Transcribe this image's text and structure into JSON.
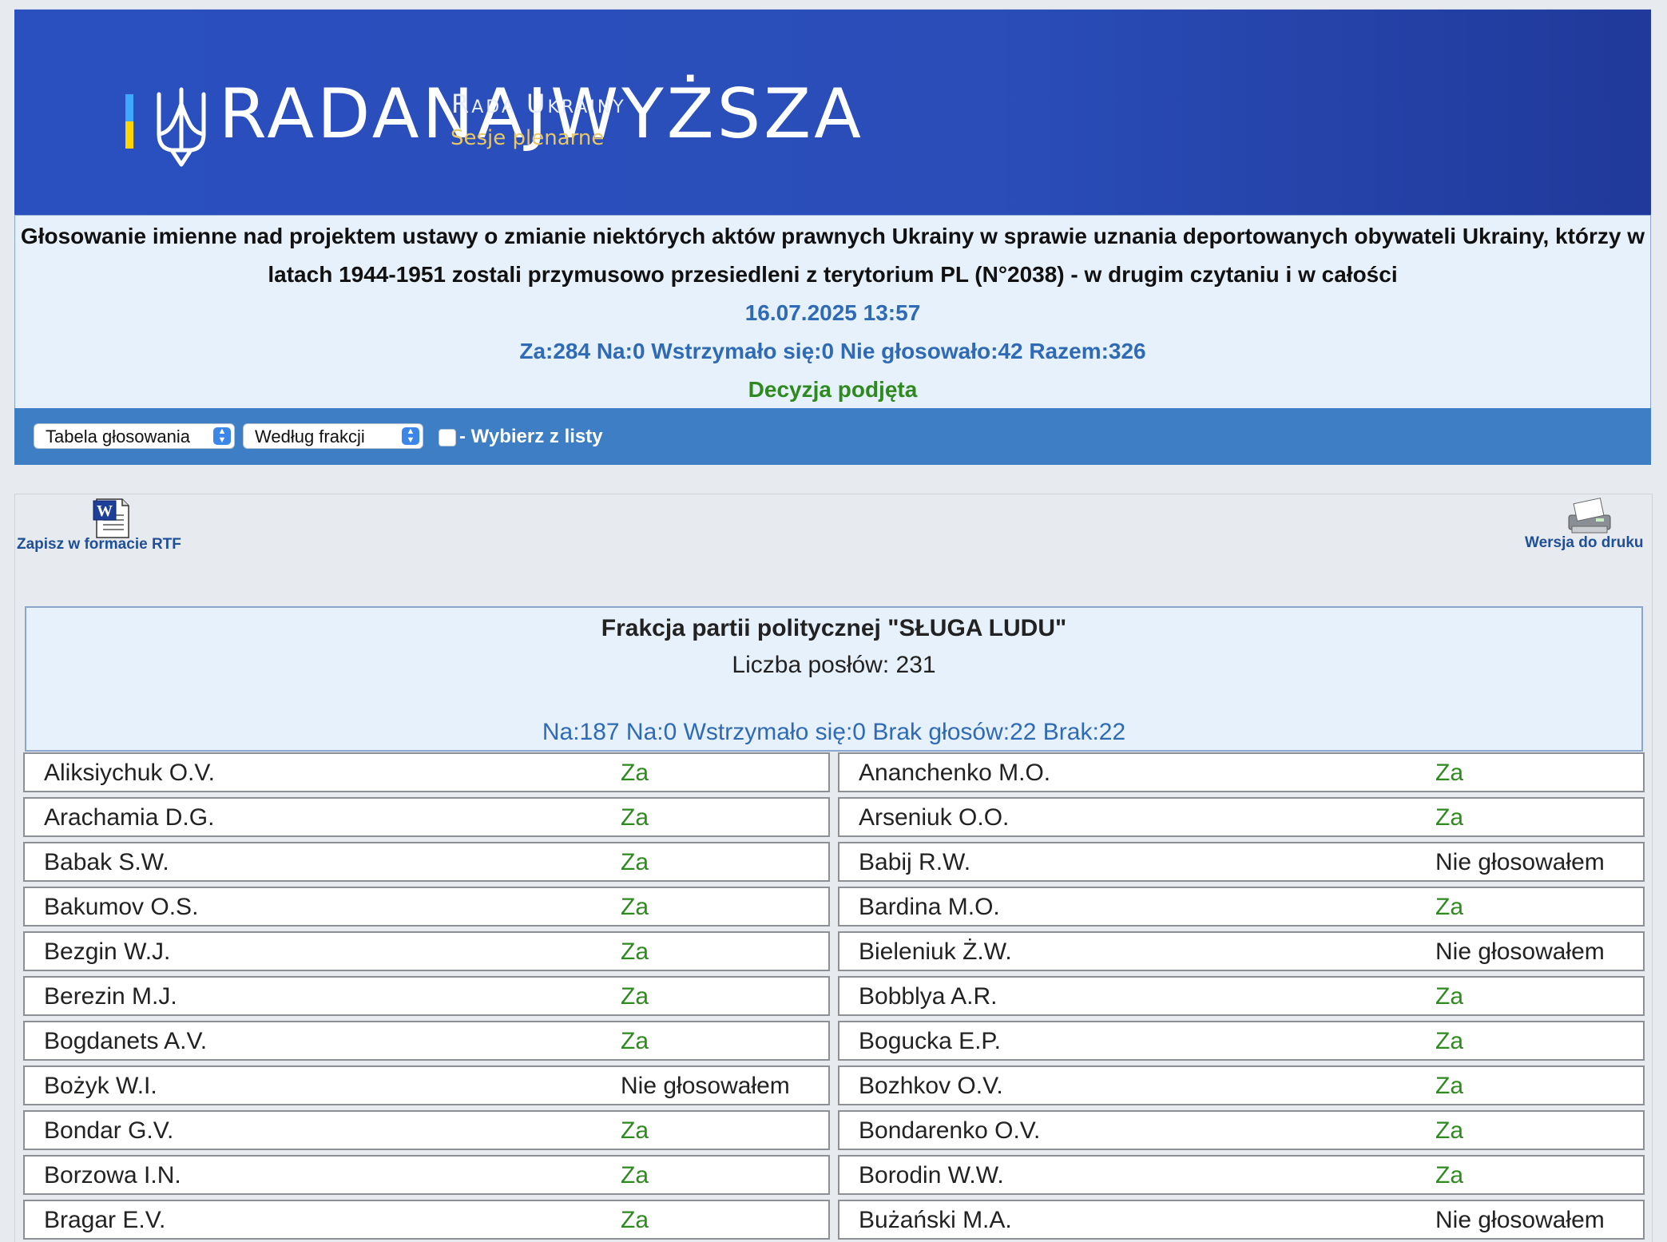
{
  "header": {
    "logo_main": "RADANAJWYŻSZA",
    "logo_rada": "Rada Ukrainy",
    "logo_sub": "Sesje plenarne"
  },
  "vote": {
    "title": "Głosowanie imienne nad projektem ustawy o zmianie niektórych aktów prawnych Ukrainy w sprawie uznania deportowanych obywateli Ukrainy, którzy w latach 1944-1951 zostali przymusowo przesiedleni z terytorium PL (N°2038) - w drugim czytaniu i w całości",
    "datetime": "16.07.2025 13:57",
    "summary": "Za:284 Na:0 Wstrzymało się:0 Nie głosowało:42 Razem:326",
    "decision": "Decyzja podjęta"
  },
  "toolbar": {
    "view_select": "Tabela głosowania",
    "group_select": "Według frakcji",
    "checkbox_label": "- Wybierz z listy"
  },
  "actions": {
    "rtf_label": "Zapisz w formacie RTF",
    "print_label": "Wersja do druku"
  },
  "faction": {
    "name": "Frakcja partii politycznej \"SŁUGA LUDU\"",
    "count": "Liczba posłów: 231",
    "stats": "Na:187 Na:0 Wstrzymało się:0 Brak głosów:22 Brak:22"
  },
  "deputies": [
    {
      "name": "Aliksiychuk O.V.",
      "vote": "Za",
      "type": "za"
    },
    {
      "name": "Ananchenko M.O.",
      "vote": "Za",
      "type": "za"
    },
    {
      "name": "Arachamia D.G.",
      "vote": "Za",
      "type": "za"
    },
    {
      "name": "Arseniuk O.O.",
      "vote": "Za",
      "type": "za"
    },
    {
      "name": "Babak S.W.",
      "vote": "Za",
      "type": "za"
    },
    {
      "name": "Babij R.W.",
      "vote": "Nie głosowałem",
      "type": "nie"
    },
    {
      "name": "Bakumov O.S.",
      "vote": "Za",
      "type": "za"
    },
    {
      "name": "Bardina M.O.",
      "vote": "Za",
      "type": "za"
    },
    {
      "name": "Bezgin W.J.",
      "vote": "Za",
      "type": "za"
    },
    {
      "name": "Bieleniuk Ż.W.",
      "vote": "Nie głosowałem",
      "type": "nie"
    },
    {
      "name": "Berezin M.J.",
      "vote": "Za",
      "type": "za"
    },
    {
      "name": "Bobblya A.R.",
      "vote": "Za",
      "type": "za"
    },
    {
      "name": "Bogdanets A.V.",
      "vote": "Za",
      "type": "za"
    },
    {
      "name": "Bogucka E.P.",
      "vote": "Za",
      "type": "za"
    },
    {
      "name": "Bożyk W.I.",
      "vote": "Nie głosowałem",
      "type": "nie"
    },
    {
      "name": "Bozhkov O.V.",
      "vote": "Za",
      "type": "za"
    },
    {
      "name": "Bondar G.V.",
      "vote": "Za",
      "type": "za"
    },
    {
      "name": "Bondarenko O.V.",
      "vote": "Za",
      "type": "za"
    },
    {
      "name": "Borzowa I.N.",
      "vote": "Za",
      "type": "za"
    },
    {
      "name": "Borodin W.W.",
      "vote": "Za",
      "type": "za"
    },
    {
      "name": "Bragar E.V.",
      "vote": "Za",
      "type": "za"
    },
    {
      "name": "Bużański M.A.",
      "vote": "Nie głosowałem",
      "type": "nie"
    }
  ]
}
